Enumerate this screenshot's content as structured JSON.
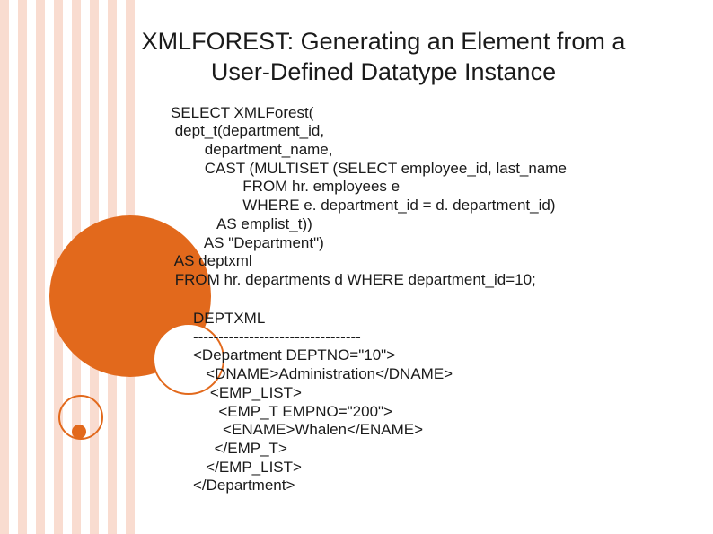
{
  "title": "XMLFOREST: Generating an Element from a User-Defined Datatype Instance",
  "sql": "SELECT XMLForest(\n dept_t(department_id,\n        department_name,\n        CAST (MULTISET (SELECT employee_id, last_name\n                 FROM hr. employees e\n                 WHERE e. department_id = d. department_id)\n           AS emplist_t))\n        AS \"Department\")\n AS deptxml\n FROM hr. departments d WHERE department_id=10;",
  "output": "DEPTXML\n---------------------------------\n<Department DEPTNO=\"10\">\n   <DNAME>Administration</DNAME>\n    <EMP_LIST>\n      <EMP_T EMPNO=\"200\">\n       <ENAME>Whalen</ENAME>\n     </EMP_T>\n   </EMP_LIST>\n</Department>"
}
